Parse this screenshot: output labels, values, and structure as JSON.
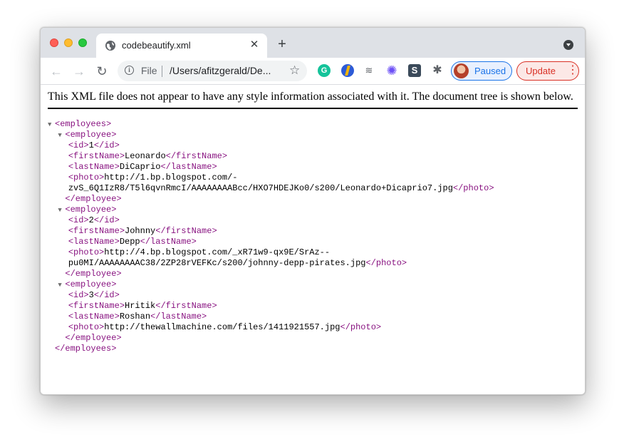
{
  "browser": {
    "tab": {
      "title": "codebeautify.xml",
      "close_glyph": "✕"
    },
    "new_tab_glyph": "+",
    "toolbar": {
      "back_glyph": "←",
      "forward_glyph": "→",
      "reload_glyph": "↻",
      "scheme": "File",
      "url": "/Users/afitzgerald/De...",
      "profile_label": "Paused",
      "update_label": "Update"
    }
  },
  "page": {
    "notice": "This XML file does not appear to have any style information associated with it. The document tree is shown below.",
    "xml": {
      "root_open": "<employees>",
      "root_close": "</employees>",
      "employees": [
        {
          "id": "1",
          "firstName": "Leonardo",
          "lastName": "DiCaprio",
          "photo_lines": [
            "http://1.bp.blogspot.com/-",
            "zvS_6Q1IzR8/T5l6qvnRmcI/AAAAAAAABcc/HXO7HDEJKo0/s200/Leonardo+Dicaprio7.jpg"
          ]
        },
        {
          "id": "2",
          "firstName": "Johnny",
          "lastName": "Depp",
          "photo_lines": [
            "http://4.bp.blogspot.com/_xR71w9-qx9E/SrAz--",
            "pu0MI/AAAAAAAAC38/2ZP28rVEFKc/s200/johnny-depp-pirates.jpg"
          ]
        },
        {
          "id": "3",
          "firstName": "Hritik",
          "lastName": "Roshan",
          "photo_lines": [
            "http://thewallmachine.com/files/1411921557.jpg"
          ]
        }
      ]
    }
  },
  "colors": {
    "xml_tag": "#881280",
    "tab_strip": "#dee1e6",
    "profile_accent": "#1a73e8",
    "update_accent": "#d93025"
  }
}
